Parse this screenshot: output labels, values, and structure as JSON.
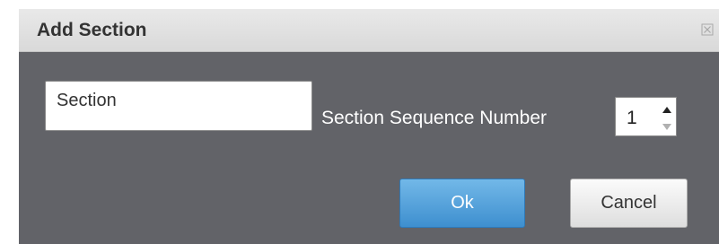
{
  "dialog": {
    "title": "Add Section",
    "close_icon": "close-icon"
  },
  "form": {
    "section_name_value": "Section",
    "sequence_label": "Section Sequence Number",
    "sequence_value": "1",
    "stepper_up_icon": "chevron-up-icon",
    "stepper_down_icon": "chevron-down-icon"
  },
  "buttons": {
    "ok_label": "Ok",
    "cancel_label": "Cancel"
  },
  "colors": {
    "dialog_body": "#626368",
    "titlebar": "#e2e2e2",
    "ok_button": "#4a9ad8",
    "cancel_button": "#ececec"
  }
}
